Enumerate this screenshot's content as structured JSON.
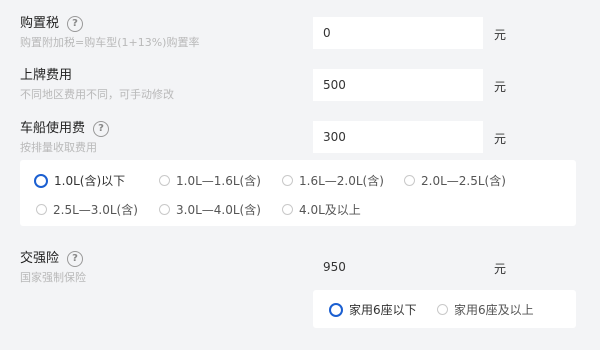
{
  "purchase_tax": {
    "label": "购置税",
    "sub": "购置附加税=购车型(1+13%)购置率",
    "value": "0",
    "unit": "元"
  },
  "plate_fee": {
    "label": "上牌费用",
    "sub": "不同地区费用不同，可手动修改",
    "value": "500",
    "unit": "元"
  },
  "vehicle_tax": {
    "label": "车船使用费",
    "sub": "按排量收取费用",
    "value": "300",
    "unit": "元",
    "options": [
      "1.0L(含)以下",
      "1.0L—1.6L(含)",
      "1.6L—2.0L(含)",
      "2.0L—2.5L(含)",
      "2.5L—3.0L(含)",
      "3.0L—4.0L(含)",
      "4.0L及以上"
    ],
    "selected_index": 0
  },
  "insurance": {
    "label": "交强险",
    "sub": "国家强制保险",
    "value": "950",
    "unit": "元",
    "options": [
      "家用6座以下",
      "家用6座及以上"
    ],
    "selected_index": 0
  },
  "help_glyph": "?",
  "colors": {
    "accent": "#1b5fd1",
    "background": "#f3f4f6"
  }
}
